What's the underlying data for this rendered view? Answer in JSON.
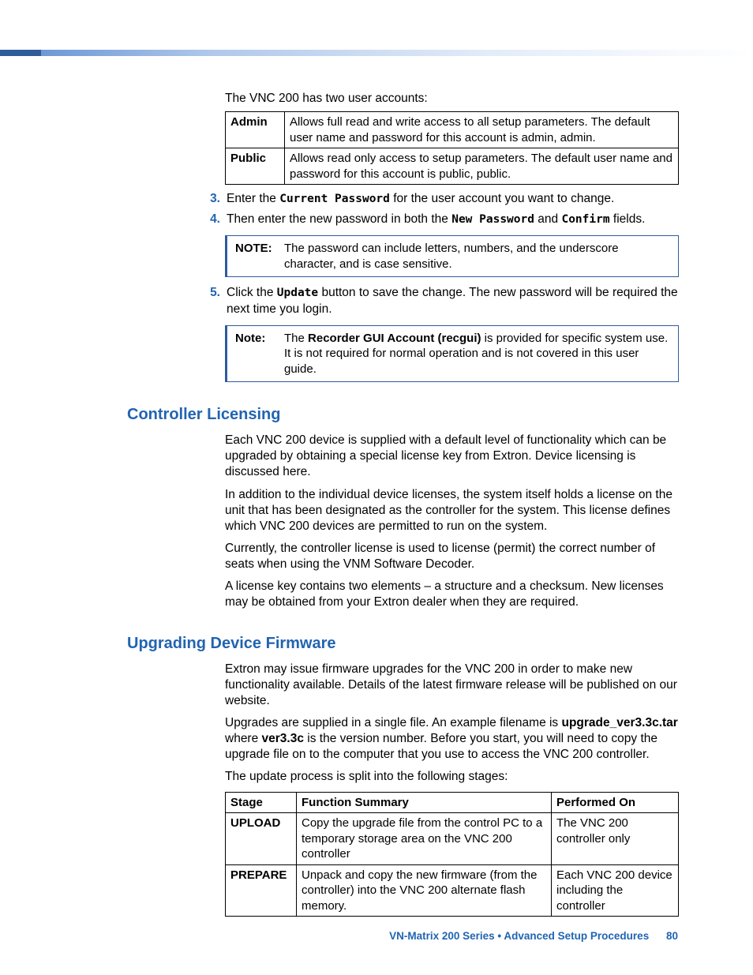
{
  "intro_line": "The VNC 200 has two user accounts:",
  "accounts_table": {
    "rows": [
      {
        "name": "Admin",
        "desc": "Allows full read and write access to all setup parameters. The default user name and password for this account is admin, admin."
      },
      {
        "name": "Public",
        "desc": "Allows read only access to setup parameters. The default user name and password for this account is public, public."
      }
    ]
  },
  "steps": {
    "s3_a": "Enter the ",
    "s3_mono": "Current Password",
    "s3_b": " for the user account you want to change.",
    "s4_a": "Then enter the new password in both the ",
    "s4_mono1": "New Password",
    "s4_b": " and ",
    "s4_mono2": "Confirm",
    "s4_c": " fields.",
    "s5_a": "Click the ",
    "s5_mono": "Update",
    "s5_b": " button to save the change. The new password will be required the next time you login."
  },
  "note1": {
    "label": "NOTE:",
    "text": "The password can include letters, numbers, and the underscore character, and is case sensitive."
  },
  "note2": {
    "label": "Note:",
    "pre": "The ",
    "bold": "Recorder GUI Account (recgui)",
    "post": " is provided for specific system use. It is not required for normal operation and is not covered in this user guide."
  },
  "licensing": {
    "title": "Controller Licensing",
    "p1": "Each VNC 200 device is supplied with a default level of functionality which can be upgraded by obtaining a special license key from Extron. Device licensing is discussed here.",
    "p2": "In addition to the individual device licenses, the system itself holds a license on the unit that has been designated as the controller for the system. This license defines which VNC 200 devices are permitted to run on the system.",
    "p3": "Currently, the controller license is used to license (permit) the correct number of seats when using the VNM Software Decoder.",
    "p4": "A license key contains two elements – a structure and a checksum. New licenses may be obtained from your Extron dealer when they are required."
  },
  "firmware": {
    "title": "Upgrading Device Firmware",
    "p1": "Extron may issue firmware upgrades for the VNC 200 in order to make new functionality available. Details of the latest firmware release will be published on our website.",
    "p2_a": "Upgrades are supplied in a single file. An example filename is ",
    "p2_bold1": "upgrade_ver3.3c.tar",
    "p2_b": " where ",
    "p2_bold2": "ver3.3c",
    "p2_c": " is the version number. Before you start, you will need to copy the upgrade file on to the computer that you use to access the VNC 200 controller.",
    "p3": "The update process is split into the following stages:"
  },
  "stages_table": {
    "headers": {
      "c1": "Stage",
      "c2": "Function Summary",
      "c3": "Performed On"
    },
    "rows": [
      {
        "stage": "UPLOAD",
        "summary": "Copy the upgrade file from the control PC to a temporary storage area on the VNC 200 controller",
        "on": "The VNC 200 controller only"
      },
      {
        "stage": "PREPARE",
        "summary": "Unpack and copy the new firmware (from the controller) into the VNC 200 alternate flash memory.",
        "on": "Each VNC 200 device including the controller"
      }
    ]
  },
  "footer": {
    "text": "VN-Matrix 200 Series  •  Advanced Setup Procedures",
    "page": "80"
  }
}
